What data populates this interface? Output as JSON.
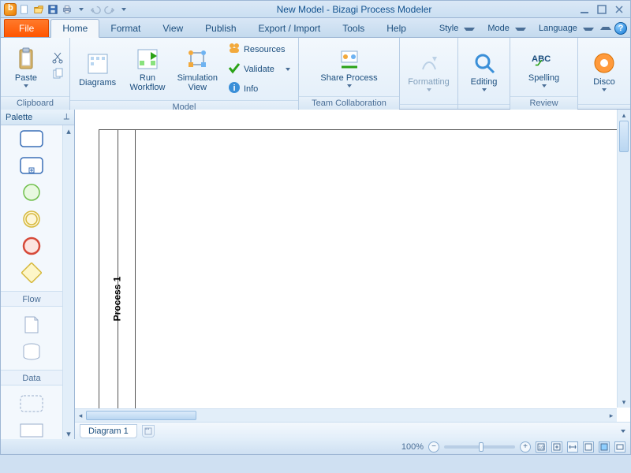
{
  "window": {
    "title": "New Model - Bizagi Process Modeler"
  },
  "ribbon_tabs": {
    "file": "File",
    "home": "Home",
    "format": "Format",
    "view": "View",
    "publish": "Publish",
    "export_import": "Export / Import",
    "tools": "Tools",
    "help": "Help"
  },
  "ribbon_right": {
    "style": "Style",
    "mode": "Mode",
    "language": "Language"
  },
  "groups": {
    "clipboard": {
      "label": "Clipboard",
      "paste": "Paste"
    },
    "model": {
      "label": "Model",
      "diagrams": "Diagrams",
      "run_workflow": "Run Workflow",
      "simulation_view": "Simulation View",
      "resources": "Resources",
      "validate": "Validate",
      "info": "Info"
    },
    "team": {
      "label": "Team Collaboration",
      "share": "Share Process"
    },
    "formatting": {
      "label": " ",
      "formatting": "Formatting"
    },
    "editing": {
      "label": " ",
      "editing": "Editing"
    },
    "review": {
      "label": "Review",
      "spelling": "Spelling"
    },
    "discover": {
      "label": " ",
      "discover": "Disco"
    }
  },
  "palette": {
    "title": "Palette",
    "section_flow": "Flow",
    "section_data": "Data"
  },
  "canvas": {
    "process_name": "Process 1"
  },
  "doc_tabs": {
    "tab1": "Diagram 1"
  },
  "status": {
    "zoom_label": "100%"
  }
}
